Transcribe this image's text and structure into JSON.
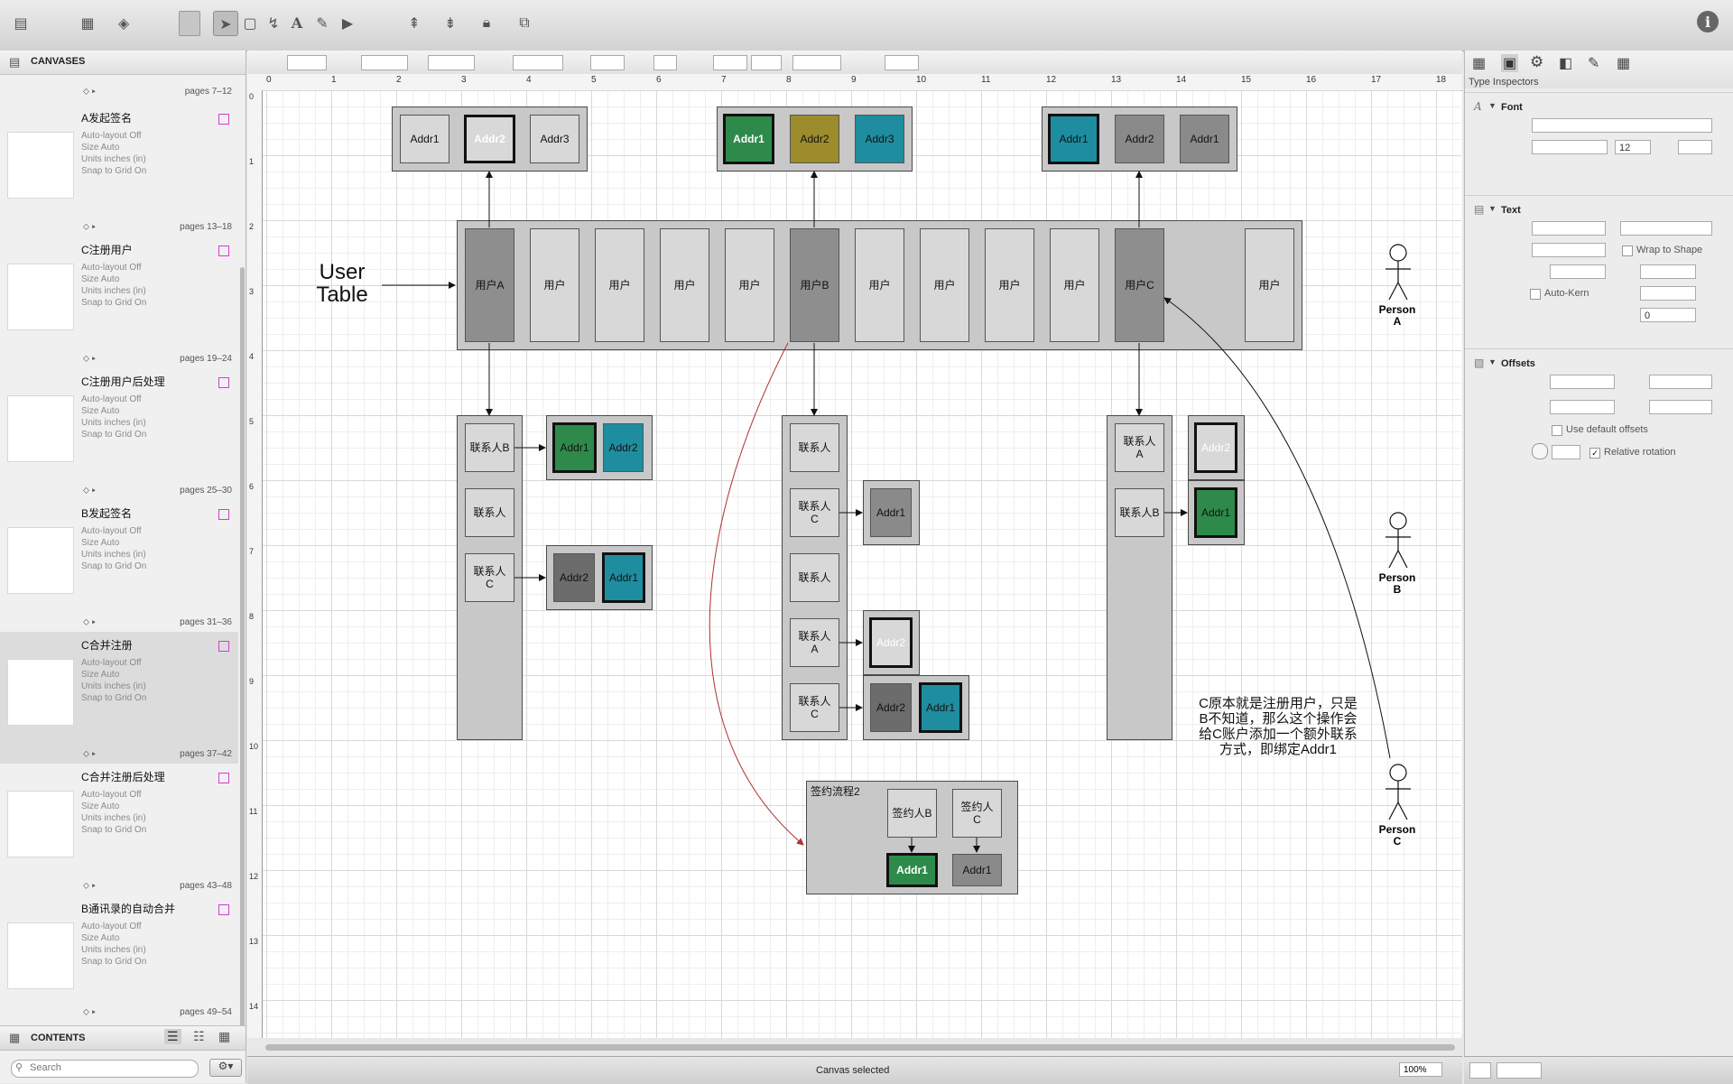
{
  "toolbar": {
    "info_label": "i"
  },
  "left_panel": {
    "header": "CANVASES",
    "canvases": [
      {
        "name": "A发起签名",
        "pages": "pages 7–12",
        "layout": "Auto-layout Off",
        "size": "Size Auto",
        "units": "Units inches (in)",
        "snap": "Snap to Grid On"
      },
      {
        "name": "C注册用户",
        "pages": "pages 13–18",
        "layout": "Auto-layout Off",
        "size": "Size Auto",
        "units": "Units inches (in)",
        "snap": "Snap to Grid On"
      },
      {
        "name": "C注册用户后处理",
        "pages": "pages 19–24",
        "layout": "Auto-layout Off",
        "size": "Size Auto",
        "units": "Units inches (in)",
        "snap": "Snap to Grid On"
      },
      {
        "name": "B发起签名",
        "pages": "pages 25–30",
        "layout": "Auto-layout Off",
        "size": "Size Auto",
        "units": "Units inches (in)",
        "snap": "Snap to Grid On"
      },
      {
        "name": "C合并注册",
        "pages": "pages 31–36",
        "layout": "Auto-layout Off",
        "size": "Size Auto",
        "units": "Units inches (in)",
        "snap": "Snap to Grid On"
      },
      {
        "name": "C合并注册后处理",
        "pages": "pages 37–42",
        "layout": "Auto-layout Off",
        "size": "Size Auto",
        "units": "Units inches (in)",
        "snap": "Snap to Grid On"
      },
      {
        "name": "B通讯录的自动合并",
        "pages": "pages 43–48",
        "layout": "Auto-layout Off",
        "size": "Size Auto",
        "units": "Units inches (in)",
        "snap": "Snap to Grid On"
      }
    ],
    "last_pages": "pages 49–54",
    "contents_label": "CONTENTS",
    "search_placeholder": "Search"
  },
  "ruler": {
    "top_ticks": [
      "0",
      "1",
      "2",
      "3",
      "4",
      "5",
      "6",
      "7",
      "8",
      "9",
      "10",
      "11",
      "12",
      "13",
      "14",
      "15",
      "16",
      "17",
      "18"
    ],
    "left_ticks": [
      "0",
      "1",
      "2",
      "3",
      "4",
      "5",
      "6",
      "7",
      "8",
      "9",
      "10",
      "11",
      "12",
      "13",
      "14"
    ]
  },
  "diagram": {
    "user_table_label": "User\nTable",
    "top_addr_groups": [
      [
        "Addr1",
        "Addr2",
        "Addr3"
      ],
      [
        "Addr1",
        "Addr2",
        "Addr3"
      ],
      [
        "Addr1",
        "Addr2",
        "Addr1"
      ]
    ],
    "users": [
      "用户A",
      "用户",
      "用户",
      "用户",
      "用户",
      "用户B",
      "用户",
      "用户",
      "用户",
      "用户",
      "用户C",
      "用户"
    ],
    "contacts_a": [
      "联系人B",
      "联系人",
      "联系人\nC"
    ],
    "contacts_a_addrs1": [
      "Addr1",
      "Addr2"
    ],
    "contacts_a_addrs2": [
      "Addr2",
      "Addr1"
    ],
    "contacts_b": [
      "联系人",
      "联系人\nC",
      "联系人",
      "联系人\nA",
      "联系人\nC"
    ],
    "contacts_b_addr_c": "Addr1",
    "contacts_b_addr_a": "Addr2",
    "contacts_b_addrs_c2": [
      "Addr2",
      "Addr1"
    ],
    "contacts_c": [
      "联系人\nA",
      "联系人B"
    ],
    "contacts_c_addrs": [
      "Addr2",
      "Addr1"
    ],
    "flow_title": "签约流程2",
    "flow_signers": [
      "签约人B",
      "签约人\nC"
    ],
    "flow_addrs": [
      "Addr1",
      "Addr1"
    ],
    "persons": [
      "Person\nA",
      "Person\nB",
      "Person\nC"
    ],
    "note": "C原本就是注册用户，只是\nB不知道，那么这个操作会\n给C账户添加一个额外联系\n方式，即绑定Addr1"
  },
  "right_panel": {
    "title": "Type Inspectors",
    "font_header": "Font",
    "font_size": "12",
    "text_header": "Text",
    "wrap_to_shape": "Wrap to Shape",
    "auto_kern": "Auto-Kern",
    "kern_value": "0",
    "offsets_header": "Offsets",
    "use_default_offsets": "Use default offsets",
    "relative_rotation": "Relative rotation"
  },
  "status": {
    "text": "Canvas selected",
    "zoom": "100%"
  }
}
